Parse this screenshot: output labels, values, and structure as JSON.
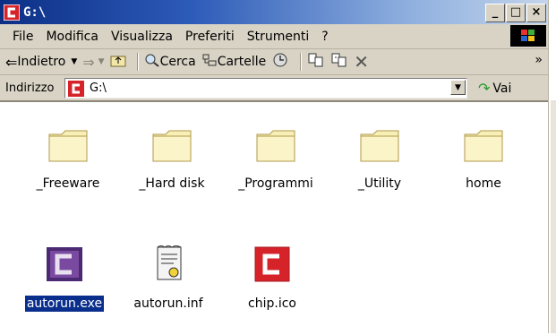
{
  "window": {
    "title": "G:\\"
  },
  "controls": {
    "minimize": "_",
    "maximize": "□",
    "close": "×"
  },
  "menu": [
    "File",
    "Modifica",
    "Visualizza",
    "Preferiti",
    "Strumenti",
    "?"
  ],
  "toolbar": {
    "back": "Indietro",
    "search": "Cerca",
    "folders": "Cartelle",
    "more": "»"
  },
  "address": {
    "label": "Indirizzo",
    "value": "G:\\",
    "go": "Vai"
  },
  "files": [
    {
      "name": "_Freeware",
      "type": "folder"
    },
    {
      "name": "_Hard disk",
      "type": "folder"
    },
    {
      "name": "_Programmi",
      "type": "folder"
    },
    {
      "name": "_Utility",
      "type": "folder"
    },
    {
      "name": "home",
      "type": "folder"
    },
    {
      "name": "autorun.exe",
      "type": "exe",
      "selected": true
    },
    {
      "name": "autorun.inf",
      "type": "inf"
    },
    {
      "name": "chip.ico",
      "type": "ico"
    }
  ],
  "colors": {
    "selection": "#0a2e8c",
    "chip_red": "#d6232a",
    "exe_purple": "#6a3b8c"
  }
}
